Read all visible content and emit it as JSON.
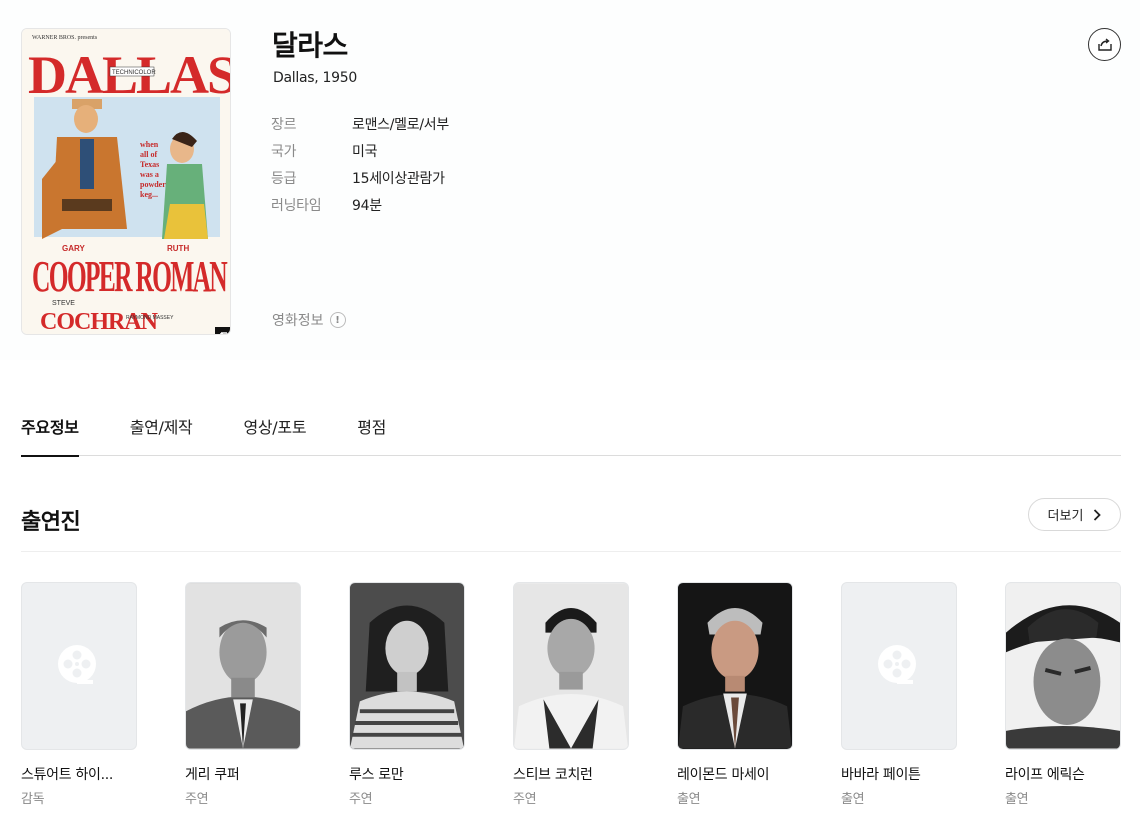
{
  "movie": {
    "title": "달라스",
    "subtitle": "Dallas, 1950",
    "poster_name": "DALLAS poster"
  },
  "meta": [
    {
      "key": "장르",
      "value": "로맨스/멜로/서부"
    },
    {
      "key": "국가",
      "value": "미국"
    },
    {
      "key": "등급",
      "value": "15세이상관람가"
    },
    {
      "key": "러닝타임",
      "value": "94분"
    }
  ],
  "movie_info_link": "영화정보",
  "tabs": [
    {
      "label": "주요정보",
      "active": true
    },
    {
      "label": "출연/제작",
      "active": false
    },
    {
      "label": "영상/포토",
      "active": false
    },
    {
      "label": "평점",
      "active": false
    }
  ],
  "cast_section": {
    "title": "출연진",
    "more_label": "더보기"
  },
  "cast": [
    {
      "name": "스튜어트 하이...",
      "role": "감독",
      "photo": "placeholder"
    },
    {
      "name": "게리 쿠퍼",
      "role": "주연",
      "photo": "bw-suit"
    },
    {
      "name": "루스 로만",
      "role": "주연",
      "photo": "bw-woman"
    },
    {
      "name": "스티브 코치런",
      "role": "주연",
      "photo": "bw-young"
    },
    {
      "name": "레이몬드 마세이",
      "role": "출연",
      "photo": "color-old"
    },
    {
      "name": "바바라 페이튼",
      "role": "출연",
      "photo": "placeholder"
    },
    {
      "name": "라이프 에릭슨",
      "role": "출연",
      "photo": "bw-hat"
    }
  ],
  "colors": {
    "accent_text": "#111111",
    "muted_text": "#8a8a8a",
    "poster_red": "#d42a2a"
  },
  "icons": {
    "share": "share-icon",
    "expand": "expand-icon",
    "info": "info-icon",
    "more": "chevron-right-icon",
    "placeholder": "film-reel-icon"
  }
}
